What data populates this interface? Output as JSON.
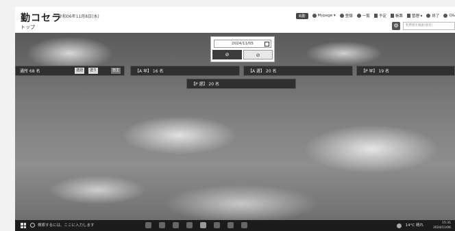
{
  "header": {
    "logo": "勤コセラ",
    "date_text": "令和06年11月8日(水)",
    "page_title": "トップ",
    "badge": "出勤",
    "nav": [
      {
        "label": "Mypage ▾"
      },
      {
        "label": "登録"
      },
      {
        "label": "一覧"
      },
      {
        "label": "予定"
      },
      {
        "label": "帳票"
      },
      {
        "label": "管理 ▾"
      },
      {
        "label": "終了"
      },
      {
        "label": "Q&"
      }
    ],
    "search_placeholder": "利用者を検索(仮名)"
  },
  "date_panel": {
    "date_value": "2024/11/05",
    "left_button": "⊘",
    "right_button": "⊘"
  },
  "bars": {
    "total": {
      "label": "通所 68 名",
      "pill1": "送迎",
      "pill2": "送り",
      "pill3": "自主"
    },
    "am_early": "【A 早】 16 名",
    "am_late": "【A 遅】 20 名",
    "pm_early": "【P 早】 19 名",
    "pm_late": "【P 遅】 20 名"
  },
  "taskbar": {
    "search_placeholder": "検索するには、ここに入力します",
    "weather": "14°C 晴れ",
    "time": "15:31",
    "date": "2024/11/06"
  }
}
